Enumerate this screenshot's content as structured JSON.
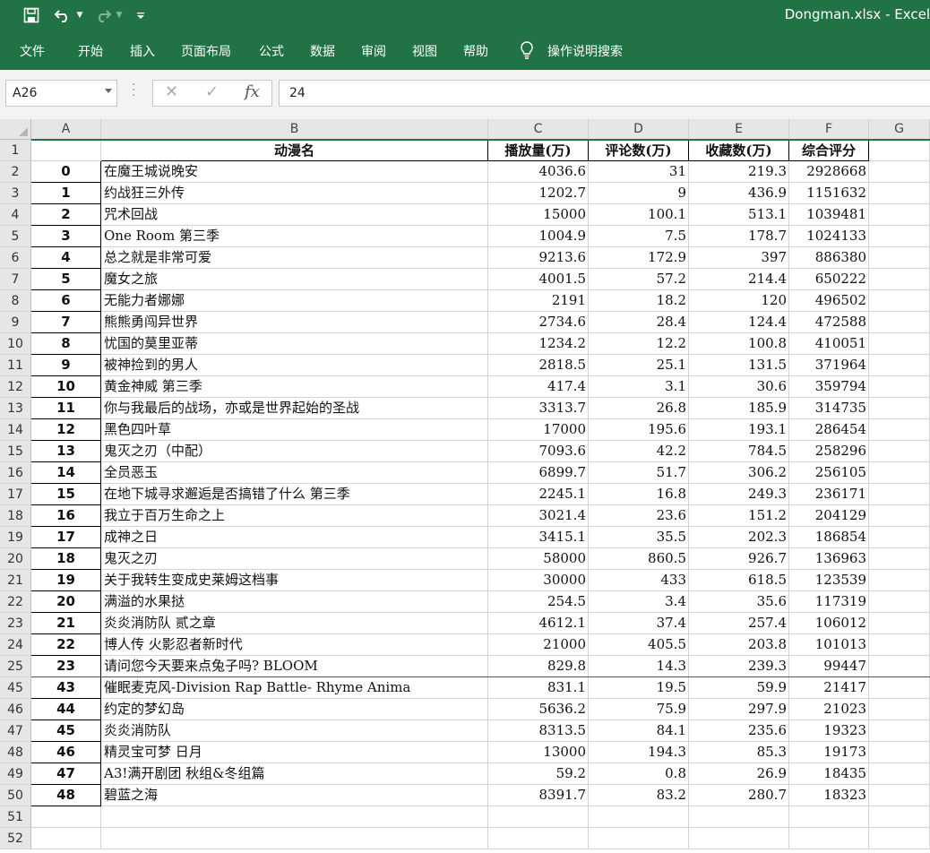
{
  "app": {
    "title": "Dongman.xlsx  -  Excel",
    "quick_access": {
      "save_icon": "save-icon",
      "undo_icon": "undo-icon",
      "redo_icon": "redo-icon",
      "customize_icon": "customize-icon"
    }
  },
  "ribbon": {
    "tabs": [
      "文件",
      "开始",
      "插入",
      "页面布局",
      "公式",
      "数据",
      "审阅",
      "视图",
      "帮助"
    ],
    "tell_me": "操作说明搜索"
  },
  "formula_bar": {
    "name_box": "A26",
    "cancel_glyph": "✕",
    "enter_glyph": "✓",
    "fx_label": "fx",
    "content": "24"
  },
  "sheet": {
    "columns": [
      "A",
      "B",
      "C",
      "D",
      "E",
      "F",
      "G"
    ],
    "header_row": {
      "row_number": "1",
      "cells": [
        "",
        "动漫名",
        "播放量(万)",
        "评论数(万)",
        "收藏数(万)",
        "综合评分"
      ]
    },
    "rows": [
      {
        "n": "2",
        "a": "0",
        "b": "在魔王城说晚安",
        "c": "4036.6",
        "d": "31",
        "e": "219.3",
        "f": "2928668"
      },
      {
        "n": "3",
        "a": "1",
        "b": "约战狂三外传",
        "c": "1202.7",
        "d": "9",
        "e": "436.9",
        "f": "1151632"
      },
      {
        "n": "4",
        "a": "2",
        "b": "咒术回战",
        "c": "15000",
        "d": "100.1",
        "e": "513.1",
        "f": "1039481"
      },
      {
        "n": "5",
        "a": "3",
        "b": "One Room 第三季",
        "c": "1004.9",
        "d": "7.5",
        "e": "178.7",
        "f": "1024133"
      },
      {
        "n": "6",
        "a": "4",
        "b": "总之就是非常可爱",
        "c": "9213.6",
        "d": "172.9",
        "e": "397",
        "f": "886380"
      },
      {
        "n": "7",
        "a": "5",
        "b": "魔女之旅",
        "c": "4001.5",
        "d": "57.2",
        "e": "214.4",
        "f": "650222"
      },
      {
        "n": "8",
        "a": "6",
        "b": "无能力者娜娜",
        "c": "2191",
        "d": "18.2",
        "e": "120",
        "f": "496502"
      },
      {
        "n": "9",
        "a": "7",
        "b": "熊熊勇闯异世界",
        "c": "2734.6",
        "d": "28.4",
        "e": "124.4",
        "f": "472588"
      },
      {
        "n": "10",
        "a": "8",
        "b": "忧国的莫里亚蒂",
        "c": "1234.2",
        "d": "12.2",
        "e": "100.8",
        "f": "410051"
      },
      {
        "n": "11",
        "a": "9",
        "b": "被神捡到的男人",
        "c": "2818.5",
        "d": "25.1",
        "e": "131.5",
        "f": "371964"
      },
      {
        "n": "12",
        "a": "10",
        "b": "黄金神威 第三季",
        "c": "417.4",
        "d": "3.1",
        "e": "30.6",
        "f": "359794"
      },
      {
        "n": "13",
        "a": "11",
        "b": "你与我最后的战场，亦或是世界起始的圣战",
        "c": "3313.7",
        "d": "26.8",
        "e": "185.9",
        "f": "314735"
      },
      {
        "n": "14",
        "a": "12",
        "b": "黑色四叶草",
        "c": "17000",
        "d": "195.6",
        "e": "193.1",
        "f": "286454"
      },
      {
        "n": "15",
        "a": "13",
        "b": "鬼灭之刃（中配）",
        "c": "7093.6",
        "d": "42.2",
        "e": "784.5",
        "f": "258296"
      },
      {
        "n": "16",
        "a": "14",
        "b": "全员恶玉",
        "c": "6899.7",
        "d": "51.7",
        "e": "306.2",
        "f": "256105"
      },
      {
        "n": "17",
        "a": "15",
        "b": "在地下城寻求邂逅是否搞错了什么 第三季",
        "c": "2245.1",
        "d": "16.8",
        "e": "249.3",
        "f": "236171"
      },
      {
        "n": "18",
        "a": "16",
        "b": "我立于百万生命之上",
        "c": "3021.4",
        "d": "23.6",
        "e": "151.2",
        "f": "204129"
      },
      {
        "n": "19",
        "a": "17",
        "b": "成神之日",
        "c": "3415.1",
        "d": "35.5",
        "e": "202.3",
        "f": "186854"
      },
      {
        "n": "20",
        "a": "18",
        "b": "鬼灭之刃",
        "c": "58000",
        "d": "860.5",
        "e": "926.7",
        "f": "136963"
      },
      {
        "n": "21",
        "a": "19",
        "b": "关于我转生变成史莱姆这档事",
        "c": "30000",
        "d": "433",
        "e": "618.5",
        "f": "123539"
      },
      {
        "n": "22",
        "a": "20",
        "b": "满溢的水果挞",
        "c": "254.5",
        "d": "3.4",
        "e": "35.6",
        "f": "117319"
      },
      {
        "n": "23",
        "a": "21",
        "b": "炎炎消防队 贰之章",
        "c": "4612.1",
        "d": "37.4",
        "e": "257.4",
        "f": "106012"
      },
      {
        "n": "24",
        "a": "22",
        "b": "博人传 火影忍者新时代",
        "c": "21000",
        "d": "405.5",
        "e": "203.8",
        "f": "101013"
      },
      {
        "n": "25",
        "a": "23",
        "b": "请问您今天要来点兔子吗? BLOOM",
        "c": "829.8",
        "d": "14.3",
        "e": "239.3",
        "f": "99447"
      },
      {
        "n": "45",
        "a": "43",
        "b": "催眠麦克风-Division Rap Battle- Rhyme Anima",
        "c": "831.1",
        "d": "19.5",
        "e": "59.9",
        "f": "21417"
      },
      {
        "n": "46",
        "a": "44",
        "b": "约定的梦幻岛",
        "c": "5636.2",
        "d": "75.9",
        "e": "297.9",
        "f": "21023"
      },
      {
        "n": "47",
        "a": "45",
        "b": "炎炎消防队",
        "c": "8313.5",
        "d": "84.1",
        "e": "235.6",
        "f": "19323"
      },
      {
        "n": "48",
        "a": "46",
        "b": "精灵宝可梦 日月",
        "c": "13000",
        "d": "194.3",
        "e": "85.3",
        "f": "19173"
      },
      {
        "n": "49",
        "a": "47",
        "b": "A3!满开剧团 秋组&冬组篇",
        "c": "59.2",
        "d": "0.8",
        "e": "26.9",
        "f": "18435"
      },
      {
        "n": "50",
        "a": "48",
        "b": "碧蓝之海",
        "c": "8391.7",
        "d": "83.2",
        "e": "280.7",
        "f": "18323"
      }
    ],
    "empty_rows": [
      "51",
      "52"
    ]
  }
}
